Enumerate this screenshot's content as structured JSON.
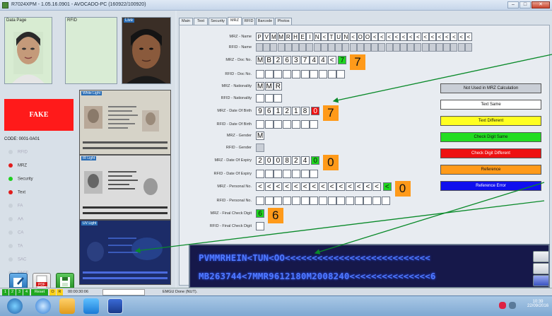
{
  "window": {
    "title": "R7024XPM - 1.05.16.0901 - AVOCADO-PC (160922/100920)",
    "min": "–",
    "max": "□",
    "close": "✕"
  },
  "left": {
    "data_page_label": "Data Page",
    "rfid_label": "RFID",
    "live_label": "Live",
    "fake_label": "FAKE",
    "code_label": "CODE:  0001-0A01",
    "status_items": [
      {
        "label": "RFID",
        "color": "#c8d0d8",
        "active": false
      },
      {
        "label": "MRZ",
        "color": "#e11c1c",
        "active": true
      },
      {
        "label": "Security",
        "color": "#1fcf1f",
        "active": true
      },
      {
        "label": "Text",
        "color": "#e11c1c",
        "active": true
      },
      {
        "label": "FA",
        "color": "#c8d0d8",
        "active": false
      },
      {
        "label": "AA",
        "color": "#c8d0d8",
        "active": false
      },
      {
        "label": "CA",
        "color": "#c8d0d8",
        "active": false
      },
      {
        "label": "TA",
        "color": "#c8d0d8",
        "active": false
      },
      {
        "label": "SAC",
        "color": "#c8d0d8",
        "active": false
      },
      {
        "label": "FACE",
        "color": "#c8d0d8",
        "active": false
      }
    ],
    "doc_images": [
      {
        "caption": "White Light"
      },
      {
        "caption": "IR Light"
      },
      {
        "caption": "UV Light"
      }
    ],
    "toolbar_icons": [
      "edit-icon",
      "pdf-icon",
      "save-icon"
    ]
  },
  "tabs": [
    "Main",
    "Text",
    "Security",
    "MRZ",
    "RFID",
    "Barcode",
    "Photos"
  ],
  "active_tab": "MRZ",
  "fields": [
    {
      "label": "MRZ - Name",
      "cells": "PVMMRHEIN<TUN<OO<<<<<<<<<<<<<<<<<<<<<<<<<<",
      "kind": "mrz"
    },
    {
      "label": "RFID - Name",
      "cells": "",
      "kind": "rfid",
      "count": 42
    },
    {
      "label": "MRZ - Doc No.",
      "cells": "MB263744<",
      "check": "7",
      "check_color": "green",
      "big": "7",
      "kind": "mrz"
    },
    {
      "label": "RFID - Doc No.",
      "cells": "",
      "kind": "rfid",
      "count": 10
    },
    {
      "label": "MRZ - Nationality",
      "cells": "MMR",
      "kind": "mrz"
    },
    {
      "label": "RFID - Nationality",
      "cells": "",
      "kind": "rfid",
      "count": 3
    },
    {
      "label": "MRZ - Date Of Birth",
      "cells": "961218",
      "check": "0",
      "check_color": "red",
      "big": "7",
      "kind": "mrz"
    },
    {
      "label": "RFID - Date Of Birth",
      "cells": "",
      "kind": "rfid",
      "count": 7
    },
    {
      "label": "MRZ - Gender",
      "cells": "M",
      "kind": "mrz"
    },
    {
      "label": "RFID - Gender",
      "cells": "",
      "kind": "rfid",
      "count": 1
    },
    {
      "label": "MRZ - Date Of Expiry",
      "cells": "200824",
      "check": "0",
      "check_color": "green",
      "big": "0",
      "kind": "mrz"
    },
    {
      "label": "RFID - Date Of Expiry",
      "cells": "",
      "kind": "rfid",
      "count": 7
    },
    {
      "label": "MRZ - Personal No.",
      "cells": "<<<<<<<<<<<<<<",
      "check": "<",
      "check_color": "green",
      "big": "0",
      "kind": "mrz"
    },
    {
      "label": "RFID - Personal No.",
      "cells": "",
      "kind": "rfid",
      "count": 15
    },
    {
      "label": "MRZ - Final Check Digit",
      "cells": "",
      "check": "6",
      "check_color": "green",
      "big": "6",
      "kind": "mrz"
    },
    {
      "label": "RFID - Final Check Digit",
      "cells": "",
      "kind": "rfid",
      "count": 1
    }
  ],
  "legend": [
    {
      "label": "Not Used in MRZ Calculation",
      "bg": "#c9ced6",
      "fg": "#111"
    },
    {
      "label": "Text Same",
      "bg": "#ffffff",
      "fg": "#111"
    },
    {
      "label": "Text Different",
      "bg": "#ffff22",
      "fg": "#111"
    },
    {
      "label": "Check Digit Same",
      "bg": "#22dd22",
      "fg": "#111"
    },
    {
      "label": "Check Digit Different",
      "bg": "#ee1111",
      "fg": "#fff"
    },
    {
      "label": "Reference",
      "bg": "#ff9a1a",
      "fg": "#111"
    },
    {
      "label": "Reference Error",
      "bg": "#1010ee",
      "fg": "#fff"
    }
  ],
  "mrz_lines": [
    "PVMMRHEIN<TUN<OO<<<<<<<<<<<<<<<<<<<<<<<<<<<",
    "MB263744<7MMR9612180M2008240<<<<<<<<<<<<<<<6"
  ],
  "statusbar": {
    "indicators": [
      "1",
      "2",
      "3",
      "4"
    ],
    "reset": "Reset",
    "o": "O",
    "r": "R",
    "timer": "00:00:30:06",
    "message": "EMGU Done (NUT)."
  },
  "taskbar": {
    "time": "10:39",
    "date": "22/09/2016",
    "tray_icons": [
      "network-icon",
      "volume-icon"
    ]
  }
}
